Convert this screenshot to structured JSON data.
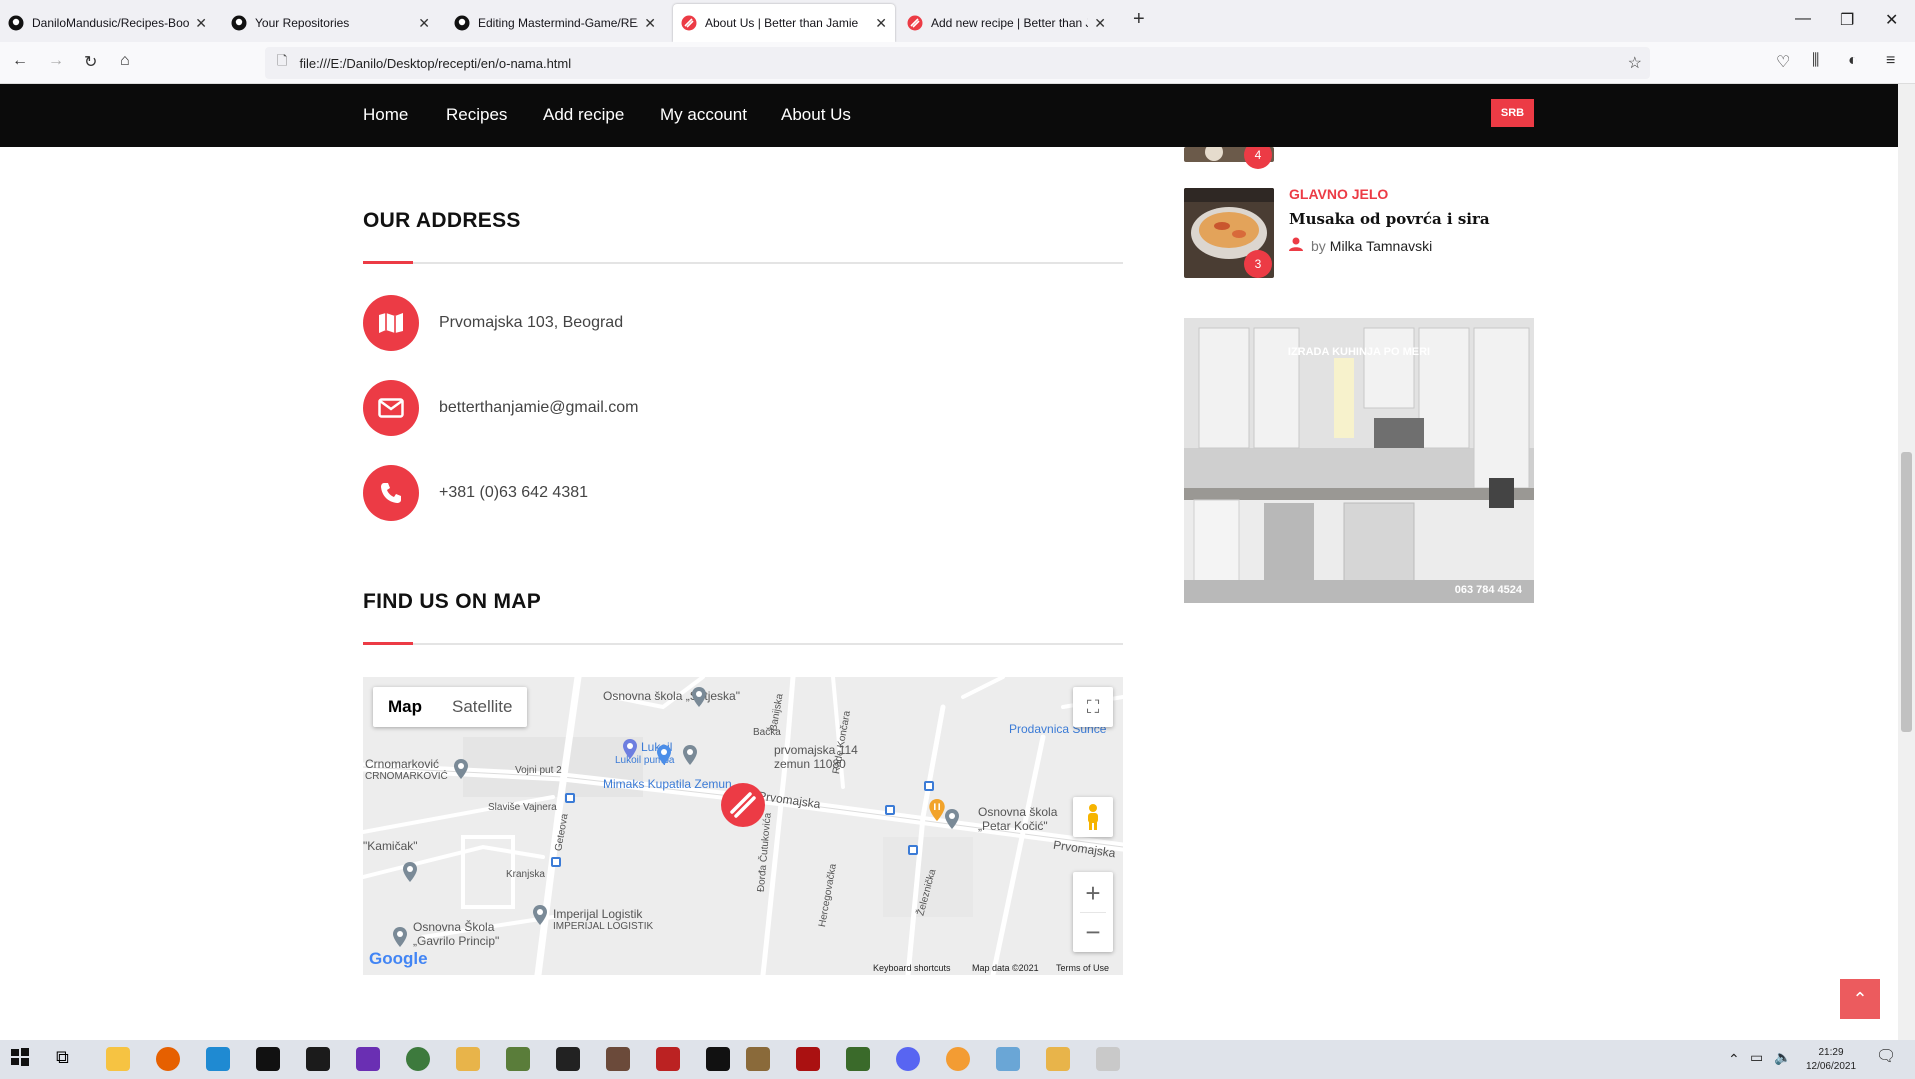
{
  "browser": {
    "tabs": [
      {
        "title": "DaniloMandusic/Recipes-Book",
        "icon": "github-icon"
      },
      {
        "title": "Your Repositories",
        "icon": "github-icon"
      },
      {
        "title": "Editing Mastermind-Game/REA",
        "icon": "github-icon"
      },
      {
        "title": "About Us | Better than Jamie",
        "icon": "site-logo-icon",
        "active": true
      },
      {
        "title": "Add new recipe | Better than Ja",
        "icon": "site-logo-icon"
      }
    ],
    "url": "file:///E:/Danilo/Desktop/recepti/en/o-nama.html"
  },
  "site_nav": {
    "items": [
      "Home",
      "Recipes",
      "Add recipe",
      "My account",
      "About Us"
    ],
    "lang_button": "SRB"
  },
  "address_section": {
    "title": "OUR ADDRESS",
    "items": [
      {
        "icon": "map-icon",
        "text": "Prvomajska 103, Beograd"
      },
      {
        "icon": "envelope-icon",
        "text": "betterthanjamie@gmail.com"
      },
      {
        "icon": "phone-icon",
        "text": "+381 (0)63 642 4381"
      }
    ]
  },
  "map_section": {
    "title": "FIND US ON MAP",
    "map_type": {
      "map": "Map",
      "satellite": "Satellite"
    },
    "labels": {
      "sutjeska": "Osnovna škola „Sutjeska\"",
      "backa": "Bačka",
      "lukoil": "Lukoil",
      "lukoil_pumpa": "Lukoil pumpa",
      "prvomajska114": "prvomajska 114",
      "zemun": "zemun 11080",
      "prodavnica": "Prodavnica Sunce",
      "crnomarkovic": "Crnomarković",
      "crnomarkovic2": "CRNOMARKOVIĆ",
      "vojni_put": "Vojni put 2",
      "mimaks": "Mimaks Kupatila Zemun",
      "prvomajska": "Prvomajska",
      "slavise": "Slaviše Vajnera",
      "kamicak": "\"Kamičak\"",
      "geteova": "Geteova",
      "kranjska": "Kranjska",
      "cutukovica": "Đorđa Čutukovića",
      "hercegovacka": "Hercegovačka",
      "rade_koncara": "Rade Končara",
      "banijska": "Banijska",
      "zeleznicka": "Železnička",
      "petar_kocic": "Osnovna škola",
      "petar_kocic2": "„Petar Kočić\"",
      "prvomajska2": "Prvomajska",
      "imperijal": "Imperijal Logistik",
      "imperijal2": "IMPERIJAL LOGISTIK",
      "gavrilo": "Osnovna Škola",
      "gavrilo2": "„Gavrilo Princip\"",
      "google": "Google"
    },
    "footer": {
      "shortcuts": "Keyboard shortcuts",
      "data": "Map data ©2021",
      "terms": "Terms of Use"
    }
  },
  "sidebar": {
    "recipe_top_badge": "4",
    "recipe": {
      "category": "GLAVNO JELO",
      "title": "Musaka od povrća i sira",
      "by": "by",
      "author": "Milka Tamnavski",
      "badge": "3"
    },
    "ad": {
      "headline": "IZRADA KUHINJA PO MERI",
      "phone": "063 784 4524"
    }
  },
  "taskbar": {
    "time": "21:29",
    "date": "12/06/2021"
  },
  "colors": {
    "accent": "#ec3b45",
    "nav_bg": "#0b0b0b"
  }
}
